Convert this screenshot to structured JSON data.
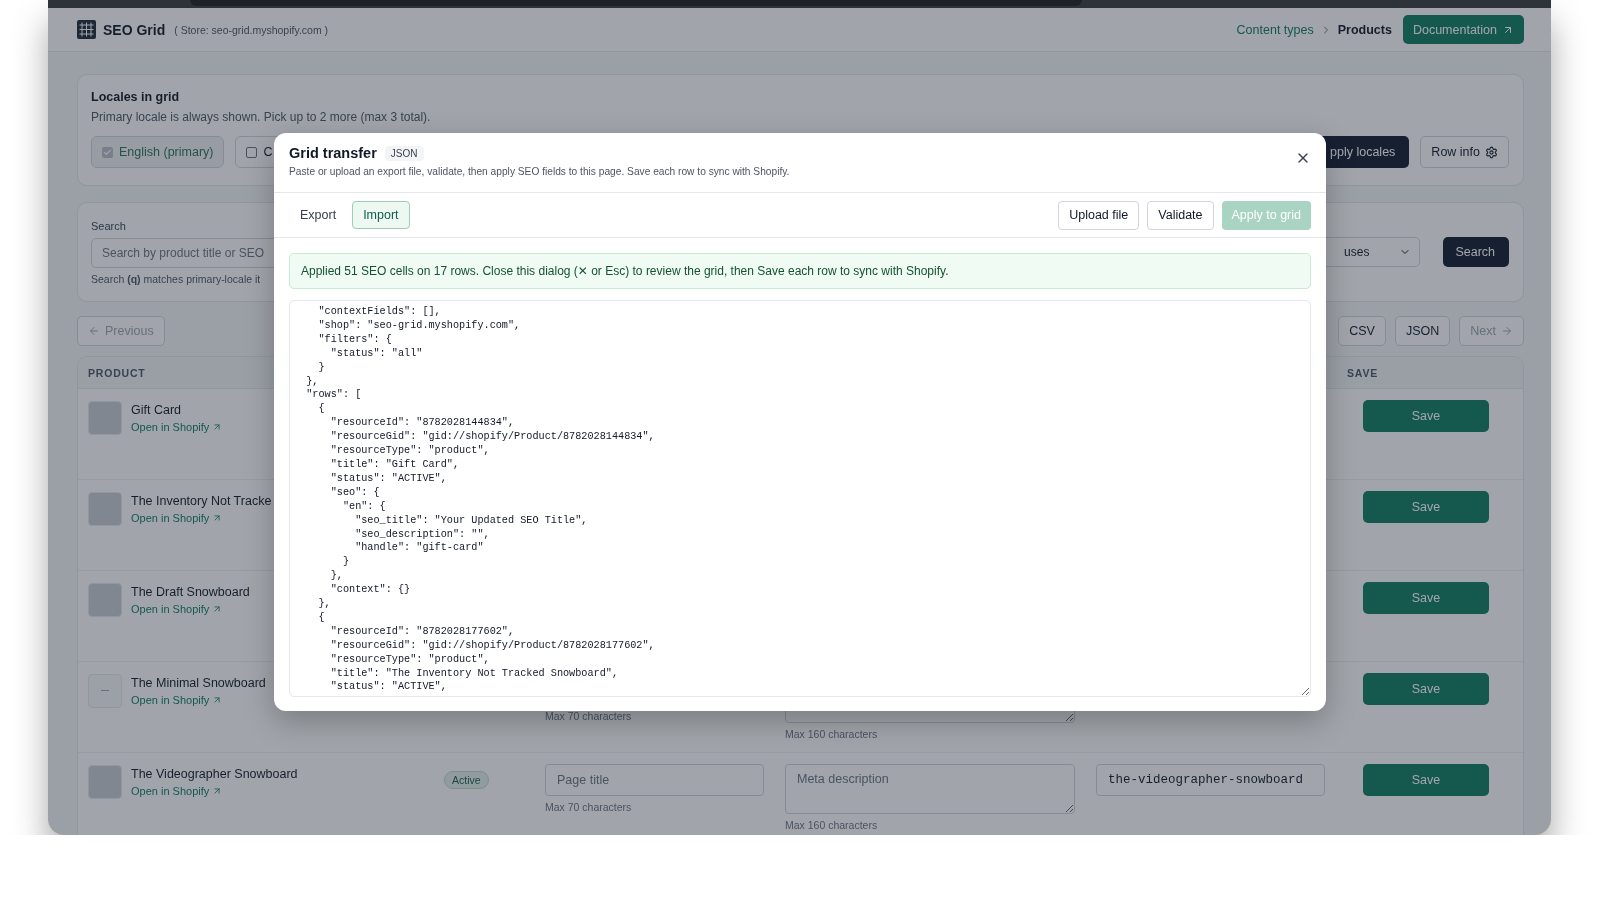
{
  "header": {
    "app_name": "SEO Grid",
    "store": "( Store: seo-grid.myshopify.com )",
    "breadcrumbs": [
      {
        "label": "Content types",
        "kind": "link"
      },
      {
        "label": "Products",
        "kind": "current"
      }
    ],
    "documentation_button": "Documentation"
  },
  "locales": {
    "title": "Locales in grid",
    "subtitle": "Primary locale is always shown. Pick up to 2 more (max 3 total).",
    "options": [
      {
        "label": "English (primary)",
        "checked": true,
        "disabled": true
      },
      {
        "label": "C",
        "checked": false,
        "disabled": false
      }
    ],
    "apply_button": "pply locales",
    "row_info_button": "Row info"
  },
  "search": {
    "label": "Search",
    "placeholder": "Search by product title or SEO",
    "hint": "Search **(q)** matches primary-locale it",
    "status_select": "uses",
    "button": "Search"
  },
  "pagination": {
    "previous": {
      "label": "Previous",
      "disabled": true
    },
    "exports": [
      "CSV",
      "JSON"
    ],
    "next": {
      "label": "Next",
      "disabled": true
    }
  },
  "table": {
    "columns": [
      {
        "label": "PRODUCT",
        "kind": "product"
      },
      {
        "label": "SAVE",
        "kind": "save"
      }
    ],
    "rows": [
      {
        "title": "Gift Card",
        "link": "Open in Shopify",
        "thumbnail": {
          "kind": "image"
        },
        "save": "Save"
      },
      {
        "title": "The Inventory Not Tracke",
        "link": "Open in Shopify",
        "thumbnail": {
          "kind": "image"
        },
        "save": "Save"
      },
      {
        "title": "The Draft Snowboard",
        "link": "Open in Shopify",
        "thumbnail": {
          "kind": "image"
        },
        "save": "Save"
      },
      {
        "title": "The Minimal Snowboard",
        "link": "Open in Shopify",
        "thumbnail": {
          "kind": "none"
        },
        "seo_title": {
          "hint": "Max 70 characters"
        },
        "seo_description": {
          "hint": "Max 160 characters"
        },
        "save": "Save"
      },
      {
        "title": "The Videographer Snowboard",
        "link": "Open in Shopify",
        "thumbnail": {
          "kind": "image"
        },
        "status": "Active",
        "seo_title": {
          "placeholder": "Page title",
          "hint": "Max 70 characters"
        },
        "seo_description": {
          "placeholder": "Meta description",
          "hint": "Max 160 characters"
        },
        "handle": {
          "value": "the-videographer-snowboard"
        },
        "save": "Save"
      }
    ]
  },
  "modal": {
    "title": "Grid transfer",
    "badge": "JSON",
    "subtitle": "Paste or upload an export file, validate, then apply SEO fields to this page. Save each row to sync with Shopify.",
    "tabs": [
      {
        "label": "Export",
        "selected": false
      },
      {
        "label": "Import",
        "selected": true
      }
    ],
    "actions": [
      {
        "label": "Upload file",
        "kind": "secondary",
        "disabled": false
      },
      {
        "label": "Validate",
        "kind": "secondary",
        "disabled": false
      },
      {
        "label": "Apply to grid",
        "kind": "primary",
        "disabled": true
      }
    ],
    "alert": {
      "kind": "success",
      "text": "Applied 51 SEO cells on 17 rows. Close this dialog (✕ or Esc) to review the grid, then Save each row to sync with Shopify."
    },
    "editor": {
      "value": "    \"contextFields\": [],\n    \"shop\": \"seo-grid.myshopify.com\",\n    \"filters\": {\n      \"status\": \"all\"\n    }\n  },\n  \"rows\": [\n    {\n      \"resourceId\": \"8782028144834\",\n      \"resourceGid\": \"gid://shopify/Product/8782028144834\",\n      \"resourceType\": \"product\",\n      \"title\": \"Gift Card\",\n      \"status\": \"ACTIVE\",\n      \"seo\": {\n        \"en\": {\n          \"seo_title\": \"Your Updated SEO Title\",\n          \"seo_description\": \"\",\n          \"handle\": \"gift-card\"\n        }\n      },\n      \"context\": {}\n    },\n    {\n      \"resourceId\": \"8782028177602\",\n      \"resourceGid\": \"gid://shopify/Product/8782028177602\",\n      \"resourceType\": \"product\",\n      \"title\": \"The Inventory Not Tracked Snowboard\",\n      \"status\": \"ACTIVE\","
    }
  }
}
